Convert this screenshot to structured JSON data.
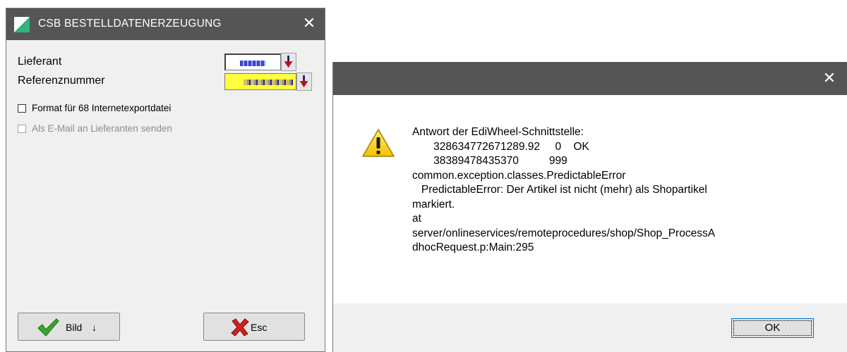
{
  "left_window": {
    "title": "CSB BESTELLDATENERZEUGUNG",
    "close_glyph": "✕",
    "fields": {
      "lieferant_label": "Lieferant",
      "referenz_label": "Referenznummer"
    },
    "checkboxes": [
      {
        "label": "Format für 68 Internetexportdatei",
        "checked": false,
        "enabled": true
      },
      {
        "label": "Als E-Mail an Lieferanten senden",
        "checked": false,
        "enabled": false
      }
    ],
    "buttons": {
      "bild_label": "Bild",
      "bild_arrow": "🠗",
      "esc_label": "Esc"
    },
    "colors": {
      "titlebar": "#555555",
      "referenz_highlight": "#ffff40",
      "logo_green": "#23a06a"
    }
  },
  "dialog": {
    "close_glyph": "✕",
    "message_lines": [
      "Antwort der EdiWheel-Schnittstelle:",
      "       328634772671289.92     0    OK",
      "       38389478435370          999",
      "common.exception.classes.PredictableError",
      "   PredictableError: Der Artikel ist nicht (mehr) als Shopartikel",
      "markiert.",
      "at",
      "server/onlineservices/remoteprocedures/shop/Shop_ProcessA",
      "dhocRequest.p:Main:295"
    ],
    "ok_label": "OK",
    "icon": "warning-icon"
  }
}
